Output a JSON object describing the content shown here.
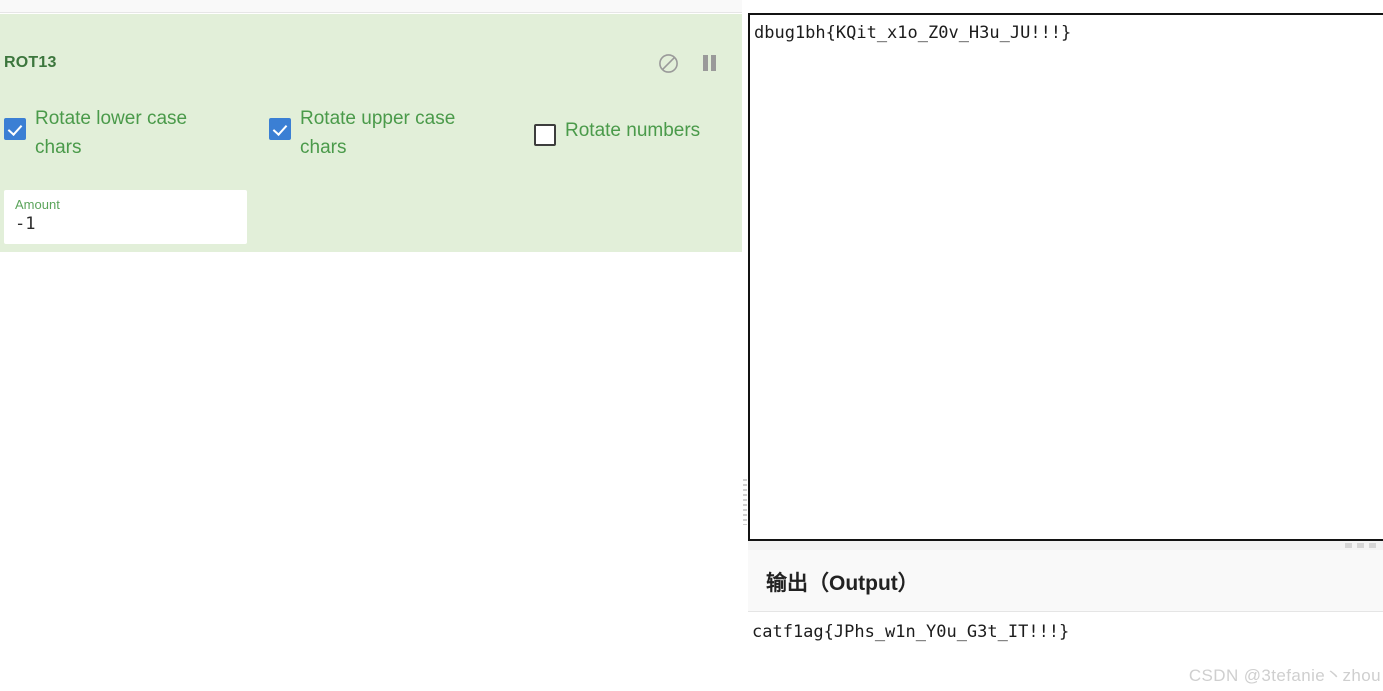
{
  "recipe": {
    "operation": {
      "name": "ROT13",
      "controls": [
        {
          "name": "disable-operation",
          "icon": "ban-icon",
          "title": "Disable operation"
        },
        {
          "name": "pause-operation",
          "icon": "pause-icon",
          "title": "Set breakpoint"
        }
      ],
      "args": {
        "checkboxes": [
          {
            "label": "Rotate lower case chars",
            "checked": true
          },
          {
            "label": "Rotate upper case chars",
            "checked": true
          },
          {
            "label": "Rotate numbers",
            "checked": false
          }
        ],
        "amount": {
          "label": "Amount",
          "value": "-1",
          "placeholder": "Amount"
        }
      }
    }
  },
  "io": {
    "input": {
      "value": "dbug1bh{KQit_x1o_Z0v_H3u_JU!!!}",
      "placeholder": ""
    },
    "output": {
      "header": "输出（Output）",
      "value": "catf1ag{JPhs_w1n_Y0u_G3t_IT!!!}"
    }
  },
  "watermark": "CSDN @3tefanie丶zhou",
  "colors": {
    "operation_background": "#e2efd9",
    "operation_title": "#3c763d",
    "arg_label": "#4a9a4a",
    "checkbox_checked": "#3b7fd4"
  }
}
